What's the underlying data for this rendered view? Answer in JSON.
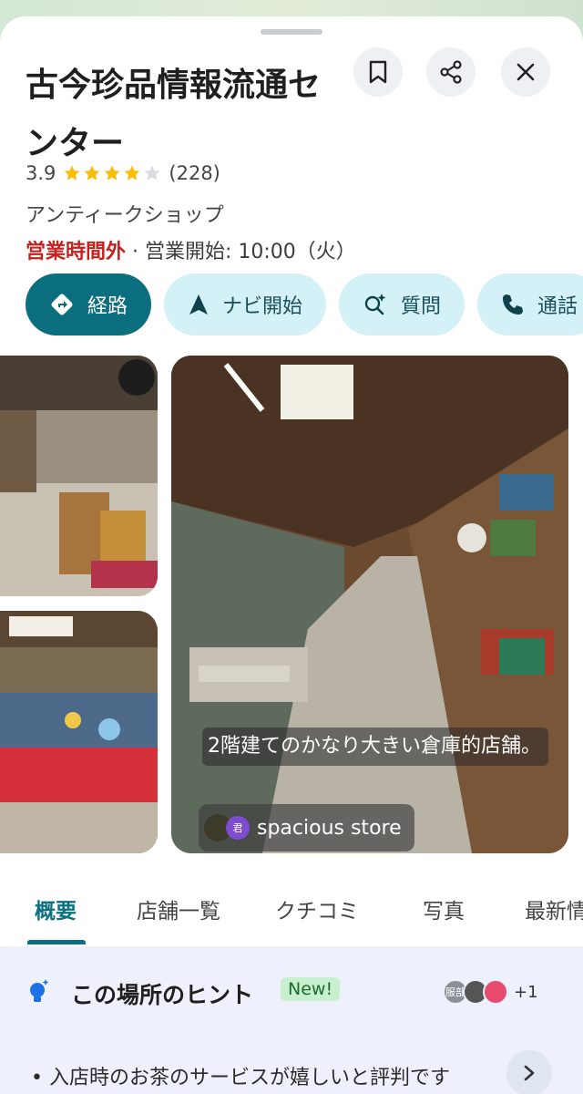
{
  "place": {
    "title": "古今珍品情報流通センター",
    "rating": "3.9",
    "rating_value": 3.9,
    "review_count": "(228)",
    "category": "アンティークショップ",
    "hours_status": "営業時間外",
    "hours_separator": " · ",
    "hours_detail": "営業開始: 10:00（火）"
  },
  "header_buttons": {
    "save_icon": "bookmark-icon",
    "share_icon": "share-icon",
    "close_icon": "close-icon"
  },
  "actions": [
    {
      "label": "経路",
      "icon": "directions-icon"
    },
    {
      "label": "ナビ開始",
      "icon": "navigation-arrow-icon"
    },
    {
      "label": "質問",
      "icon": "ask-sparkle-icon"
    },
    {
      "label": "通話",
      "icon": "phone-icon"
    }
  ],
  "photo_caption": {
    "text": "2階建てのかなり大きい倉庫的店舗。",
    "user_badge": "君",
    "user_name": "spacious store"
  },
  "tabs": [
    "概要",
    "店舗一覧",
    "クチコミ",
    "写真",
    "最新情報"
  ],
  "tips": {
    "title": "この場所のヒント",
    "new_badge": "New!",
    "avatar_label": "服部",
    "more_count": "+1",
    "tip": "入店時のお茶のサービスが嬉しいと評判です"
  },
  "colors": {
    "accent": "#0c6f80",
    "closed": "#c5221f",
    "star": "#fbbc04"
  }
}
